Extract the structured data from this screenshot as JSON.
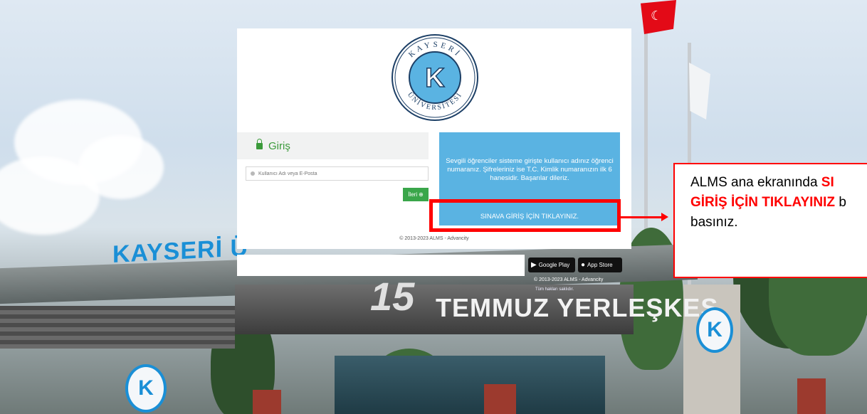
{
  "colors": {
    "accent_green": "#3a9a3a",
    "info_blue": "#5ab3e2",
    "highlight_red": "#ff0000"
  },
  "logo": {
    "text_top": "KAYSERİ",
    "text_bottom": "ÜNİVERSİTESİ",
    "letter": "K"
  },
  "login": {
    "title": "Giriş",
    "username_placeholder": "Kullanıcı Adı veya E-Posta",
    "next_label": "İleri"
  },
  "info": {
    "message": "Sevgili öğrenciler sisteme girişte kullanıcı adınız öğrenci numaranız. Şifreleriniz ise T.C. Kimlik numaranızın ilk 6 hanesidir. Başarılar dileriz.",
    "exam_button_label": "SINAVA GİRİŞ İÇİN TIKLAYINIZ."
  },
  "copyright": "© 2013-2023 ALMS - Advancity",
  "stores": {
    "google_play": "Google Play",
    "app_store": "App Store"
  },
  "footer": {
    "copy": "© 2013-2023 ALMS - Advancity",
    "rights": "Tüm hakları saklıdır."
  },
  "scene": {
    "sign_left": "KAYSERİ Ü",
    "sign_campus": "TEMMUZ YERLEŞKES",
    "sign_number": "15"
  },
  "callout": {
    "line1_plain": "ALMS ana ekranında ",
    "line1_red": "SI",
    "line2_red": "GİRİŞ İÇİN TIKLAYINIZ",
    "line2_plain": " b",
    "line3": "basınız."
  }
}
